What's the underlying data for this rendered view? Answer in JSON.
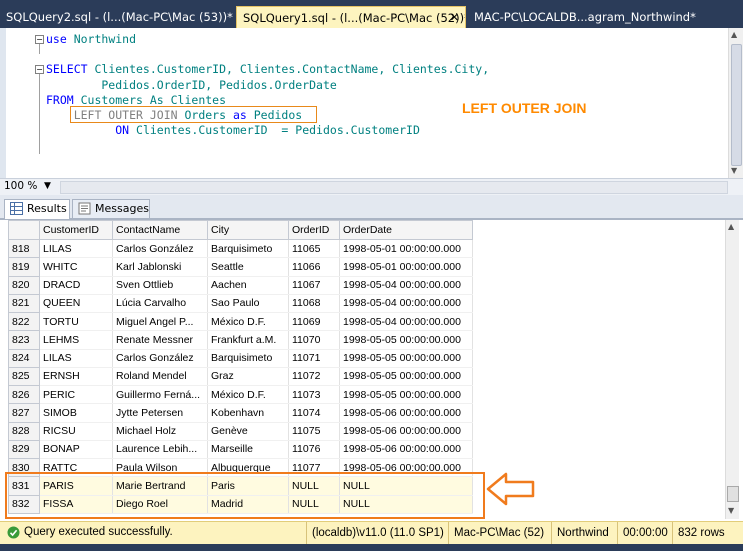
{
  "tabs": [
    {
      "label": "SQLQuery2.sql - (l...(Mac-PC\\Mac (53))*",
      "close": ""
    },
    {
      "label": "SQLQuery1.sql - (l...(Mac-PC\\Mac (52))*",
      "close": "✕"
    },
    {
      "label": "MAC-PC\\LOCALDB...agram_Northwind*",
      "close": ""
    }
  ],
  "editor": {
    "line1": {
      "kw": "use",
      "rest": " Northwind"
    },
    "line2": {
      "kw": "SELECT",
      "rest": " Clientes.CustomerID, Clientes.ContactName, Clientes.City,"
    },
    "line3": {
      "rest": "        Pedidos.OrderID, Pedidos.OrderDate"
    },
    "line4": {
      "kw": "FROM",
      "rest": " Customers As Clientes"
    },
    "line5": {
      "gray": "    LEFT OUTER JOIN",
      "mid": " Orders ",
      "kw": "as",
      "rest": " Pedidos"
    },
    "line6": {
      "indent": "          ",
      "kw": "ON",
      "rest": " Clientes.CustomerID  = Pedidos.CustomerID"
    },
    "annotation": "LEFT OUTER JOIN",
    "annotation_color": "#ff8a00"
  },
  "zoom": "100 %",
  "result_tabs": {
    "results": "Results",
    "messages": "Messages"
  },
  "grid": {
    "columns": [
      "CustomerID",
      "ContactName",
      "City",
      "OrderID",
      "OrderDate"
    ],
    "rows": [
      {
        "n": "818",
        "id": "LILAS",
        "contact": "Carlos González",
        "city": "Barquisimeto",
        "order": "11065",
        "date": "1998-05-01 00:00:00.000"
      },
      {
        "n": "819",
        "id": "WHITC",
        "contact": "Karl Jablonski",
        "city": "Seattle",
        "order": "11066",
        "date": "1998-05-01 00:00:00.000"
      },
      {
        "n": "820",
        "id": "DRACD",
        "contact": "Sven Ottlieb",
        "city": "Aachen",
        "order": "11067",
        "date": "1998-05-04 00:00:00.000"
      },
      {
        "n": "821",
        "id": "QUEEN",
        "contact": "Lúcia Carvalho",
        "city": "Sao Paulo",
        "order": "11068",
        "date": "1998-05-04 00:00:00.000"
      },
      {
        "n": "822",
        "id": "TORTU",
        "contact": "Miguel Angel P...",
        "city": "México D.F.",
        "order": "11069",
        "date": "1998-05-04 00:00:00.000"
      },
      {
        "n": "823",
        "id": "LEHMS",
        "contact": "Renate Messner",
        "city": "Frankfurt a.M.",
        "order": "11070",
        "date": "1998-05-05 00:00:00.000"
      },
      {
        "n": "824",
        "id": "LILAS",
        "contact": "Carlos González",
        "city": "Barquisimeto",
        "order": "11071",
        "date": "1998-05-05 00:00:00.000"
      },
      {
        "n": "825",
        "id": "ERNSH",
        "contact": "Roland Mendel",
        "city": "Graz",
        "order": "11072",
        "date": "1998-05-05 00:00:00.000"
      },
      {
        "n": "826",
        "id": "PERIC",
        "contact": "Guillermo Ferná...",
        "city": "México D.F.",
        "order": "11073",
        "date": "1998-05-05 00:00:00.000"
      },
      {
        "n": "827",
        "id": "SIMOB",
        "contact": "Jytte Petersen",
        "city": "Kobenhavn",
        "order": "11074",
        "date": "1998-05-06 00:00:00.000"
      },
      {
        "n": "828",
        "id": "RICSU",
        "contact": "Michael Holz",
        "city": "Genève",
        "order": "11075",
        "date": "1998-05-06 00:00:00.000"
      },
      {
        "n": "829",
        "id": "BONAP",
        "contact": "Laurence Lebih...",
        "city": "Marseille",
        "order": "11076",
        "date": "1998-05-06 00:00:00.000"
      },
      {
        "n": "830",
        "id": "RATTC",
        "contact": "Paula Wilson",
        "city": "Albuquerque",
        "order": "11077",
        "date": "1998-05-06 00:00:00.000"
      },
      {
        "n": "831",
        "id": "PARIS",
        "contact": "Marie Bertrand",
        "city": "Paris",
        "order": "NULL",
        "date": "NULL",
        "highlight": true
      },
      {
        "n": "832",
        "id": "FISSA",
        "contact": "Diego Roel",
        "city": "Madrid",
        "order": "NULL",
        "date": "NULL",
        "highlight": true
      }
    ]
  },
  "status": {
    "message": "Query executed successfully.",
    "server": "(localdb)\\v11.0 (11.0 SP1)",
    "user": "Mac-PC\\Mac (52)",
    "database": "Northwind",
    "elapsed": "00:00:00",
    "rows": "832 rows"
  },
  "colors": {
    "tab_bar": "#2b3c59",
    "status_bar": "#fdf3bf",
    "annotation": "#ff8a00"
  }
}
